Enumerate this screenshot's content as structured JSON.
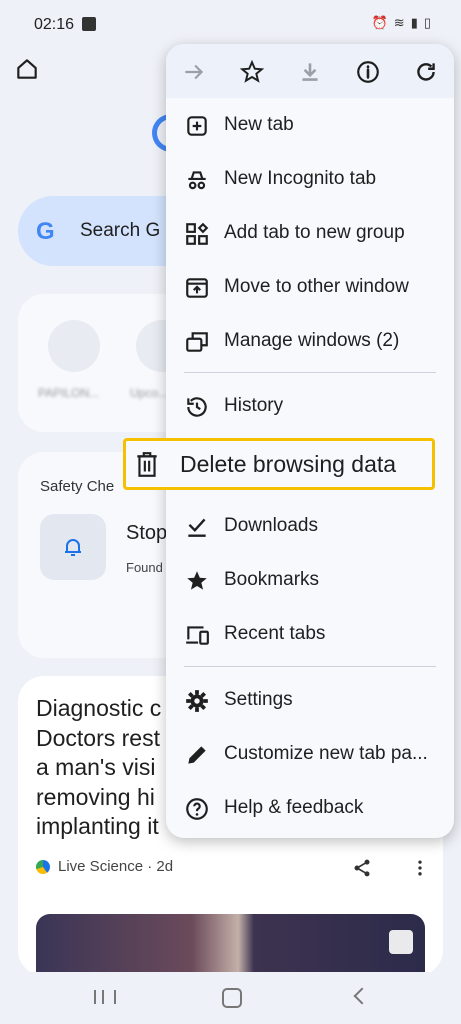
{
  "status": {
    "time": "02:16"
  },
  "background": {
    "search_placeholder": "Search G",
    "tiles": [
      "PAPILON...",
      "Upco..."
    ],
    "safety_title": "Safety Che",
    "safety_stop": "Stop",
    "safety_found": "Found",
    "news": {
      "headline": "Diagnostic c\nDoctors rest\na man's visi\nremoving hi\nimplanting it",
      "source": "Live Science · 2d"
    }
  },
  "menu": {
    "toolbar": [
      "forward-icon",
      "star-icon",
      "download-icon",
      "info-icon",
      "refresh-icon"
    ],
    "items": [
      {
        "label": "New tab",
        "icon": "plus-box-icon"
      },
      {
        "label": "New Incognito tab",
        "icon": "incognito-icon"
      },
      {
        "label": "Add tab to new group",
        "icon": "group-icon"
      },
      {
        "label": "Move to other window",
        "icon": "move-window-icon"
      },
      {
        "label": "Manage windows (2)",
        "icon": "windows-icon"
      },
      {
        "label": "History",
        "icon": "history-icon"
      },
      {
        "label": "Delete browsing data",
        "icon": "trash-icon"
      },
      {
        "label": "Downloads",
        "icon": "downloads-icon"
      },
      {
        "label": "Bookmarks",
        "icon": "bookmark-star-icon"
      },
      {
        "label": "Recent tabs",
        "icon": "devices-icon"
      },
      {
        "label": "Settings",
        "icon": "gear-icon"
      },
      {
        "label": "Customize new tab pa...",
        "icon": "pencil-icon"
      },
      {
        "label": "Help & feedback",
        "icon": "help-icon"
      }
    ]
  },
  "colors": {
    "highlight": "#f4c000",
    "accent": "#1a73e8"
  }
}
